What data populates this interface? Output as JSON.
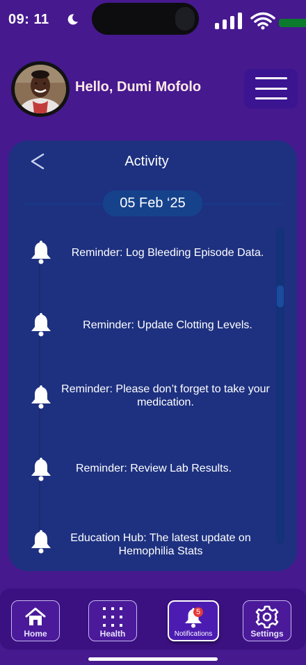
{
  "status_bar": {
    "time": "09: 11",
    "icons": [
      "moon-icon",
      "signal-icon",
      "wifi-icon",
      "battery-icon"
    ]
  },
  "header": {
    "greeting": "Hello,  Dumi Mofolo",
    "menu_icon": "hamburger-menu-icon"
  },
  "activity": {
    "back_icon": "chevron-left-icon",
    "title": "Activity",
    "date": "05 Feb ‘25",
    "items": [
      {
        "icon": "bell-icon",
        "text": "Reminder: Log Bleeding Episode Data."
      },
      {
        "icon": "bell-icon",
        "text": "Reminder: Update Clotting Levels."
      },
      {
        "icon": "bell-icon",
        "text": "Reminder:  Please  don’t forget to take your medication."
      },
      {
        "icon": "bell-icon",
        "text": "Reminder:   Review Lab Results."
      },
      {
        "icon": "bell-icon",
        "text": "Education Hub: The latest update on Hemophilia Stats"
      }
    ]
  },
  "nav": {
    "items": [
      {
        "label": "Home",
        "icon": "home-icon"
      },
      {
        "label": "Health",
        "icon": "grid-icon"
      },
      {
        "label": "Notifications",
        "icon": "bell-icon",
        "badge": "5",
        "active": true
      },
      {
        "label": "Settings",
        "icon": "gear-icon"
      }
    ]
  },
  "colors": {
    "background": "#46198f",
    "card": "#1e3180",
    "date_pill": "#16428c",
    "nav": "#3b1181",
    "badge": "#e53939"
  }
}
